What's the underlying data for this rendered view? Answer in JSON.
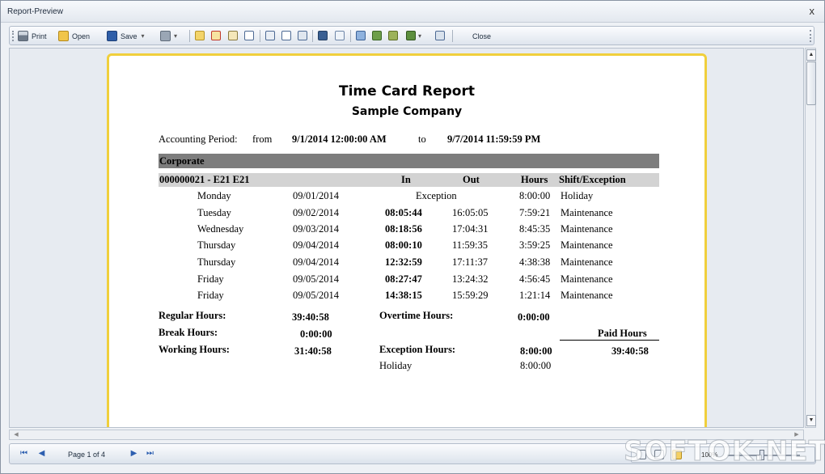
{
  "window": {
    "title": "Report-Preview",
    "close_glyph": "x"
  },
  "toolbar": {
    "print_label": "Print",
    "open_label": "Open",
    "save_label": "Save",
    "close_label": "Close",
    "dropdown_glyph": "▾"
  },
  "report": {
    "title": "Time Card Report",
    "company": "Sample Company",
    "period_label": "Accounting Period:",
    "from_label": "from",
    "from_value": "9/1/2014 12:00:00 AM",
    "to_label": "to",
    "to_value": "9/7/2014 11:59:59 PM",
    "group_name": "Corporate",
    "employee": "000000021 - E21 E21",
    "headers": {
      "in": "In",
      "out": "Out",
      "hours": "Hours",
      "shift": "Shift/Exception"
    },
    "rows": [
      {
        "day": "Monday",
        "date": "09/01/2014",
        "in": "Exception",
        "out": "",
        "hours": "8:00:00",
        "shift": "Holiday"
      },
      {
        "day": "Tuesday",
        "date": "09/02/2014",
        "in": "08:05:44",
        "out": "16:05:05",
        "hours": "7:59:21",
        "shift": "Maintenance"
      },
      {
        "day": "Wednesday",
        "date": "09/03/2014",
        "in": "08:18:56",
        "out": "17:04:31",
        "hours": "8:45:35",
        "shift": "Maintenance"
      },
      {
        "day": "Thursday",
        "date": "09/04/2014",
        "in": "08:00:10",
        "out": "11:59:35",
        "hours": "3:59:25",
        "shift": "Maintenance"
      },
      {
        "day": "Thursday",
        "date": "09/04/2014",
        "in": "12:32:59",
        "out": "17:11:37",
        "hours": "4:38:38",
        "shift": "Maintenance"
      },
      {
        "day": "Friday",
        "date": "09/05/2014",
        "in": "08:27:47",
        "out": "13:24:32",
        "hours": "4:56:45",
        "shift": "Maintenance"
      },
      {
        "day": "Friday",
        "date": "09/05/2014",
        "in": "14:38:15",
        "out": "15:59:29",
        "hours": "1:21:14",
        "shift": "Maintenance"
      }
    ],
    "summary": {
      "regular_label": "Regular Hours:",
      "regular_value": "39:40:58",
      "overtime_label": "Overtime Hours:",
      "overtime_value": "0:00:00",
      "break_label": "Break Hours:",
      "break_value": "0:00:00",
      "paid_label": "Paid Hours",
      "working_label": "Working Hours:",
      "working_value": "31:40:58",
      "exception_label": "Exception Hours:",
      "exception_value": "8:00:00",
      "paid_value": "39:40:58",
      "holiday_label": "Holiday",
      "holiday_value": "8:00:00"
    }
  },
  "statusbar": {
    "page_text": "Page 1 of 4",
    "zoom_text": "100%"
  },
  "watermark": "SOFTOK.NET",
  "icons": {
    "print": "printer-icon",
    "open": "folder-open-icon",
    "save": "floppy-disk-icon"
  },
  "colors": {
    "page_border": "#f0cf3c",
    "band_dark": "#7d7d7d",
    "band_light": "#d3d3d3",
    "nav_blue": "#2d5fb0"
  }
}
